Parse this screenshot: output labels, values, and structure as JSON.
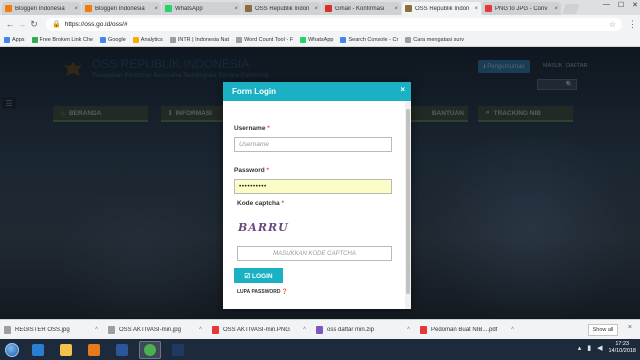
{
  "browser": {
    "tabs": [
      {
        "label": "Bloggen Indonesia",
        "favicon_color": "#f57c00",
        "active": false
      },
      {
        "label": "Bloggen Indonesia",
        "favicon_color": "#f57c00",
        "active": false
      },
      {
        "label": "WhatsApp",
        "favicon_color": "#25d366",
        "active": false
      },
      {
        "label": "OSS Republik Indon",
        "favicon_color": "#8d6e3a",
        "active": false
      },
      {
        "label": "Gmail - Konfirmasi",
        "favicon_color": "#d93025",
        "active": false
      },
      {
        "label": "OSS Republik Indon",
        "favicon_color": "#8d6e3a",
        "active": true
      },
      {
        "label": "PNG to JPG - Conv",
        "favicon_color": "#e53935",
        "active": false
      }
    ],
    "tab_close_glyph": "×",
    "window_controls": {
      "minimize": "—",
      "maximize": "☐",
      "close": "✕"
    },
    "url": "https://oss.go.id/oss/#",
    "bookmarks": [
      {
        "label": "Apps",
        "icon_color": "#4285f4"
      },
      {
        "label": "Free Broken Link Che",
        "icon_color": "#34a853"
      },
      {
        "label": "Google",
        "icon_color": "#4285f4"
      },
      {
        "label": "Analytics",
        "icon_color": "#f9ab00"
      },
      {
        "label": "INTR | Indonesia Nat",
        "icon_color": "#9e9e9e"
      },
      {
        "label": "Word Count Tool - F",
        "icon_color": "#9e9e9e"
      },
      {
        "label": "WhatsApp",
        "icon_color": "#25d366"
      },
      {
        "label": "Search Console - Cr",
        "icon_color": "#4285f4"
      },
      {
        "label": "Cara mengatasi surv",
        "icon_color": "#9e9e9e"
      }
    ]
  },
  "site": {
    "title": "OSS REPUBLIK INDONESIA",
    "subtitle": "Pelayanan Perizinan Berusaha Terintegrasi Secara Elektronik",
    "pengumuman": "ℹ Pengumuman",
    "masuk": "MASUK",
    "daftar": "DAFTAR",
    "search_icon": "search-icon",
    "nav": {
      "beranda": "BERANDA",
      "informasi": "INFORMASI",
      "bantuan": "BANTUAN",
      "tracking": "TRACKING NIB"
    }
  },
  "modal": {
    "title": "Form Login",
    "close_glyph": "×",
    "username_label": "Username",
    "username_placeholder": "Username",
    "password_label": "Password",
    "password_value": "••••••••••",
    "captcha_label": "Kode captcha",
    "captcha_text": "BARRU",
    "captcha_placeholder": "MASUKKAN KODE CAPTCHA",
    "required_mark": "*",
    "login_button": "☑ LOGIN",
    "forgot_password": "LUPA PASSWORD ❓"
  },
  "downloads": {
    "items": [
      {
        "label": "REGISTER OSS.jpg",
        "icon_color": "#9e9e9e"
      },
      {
        "label": "OSS AKTIVASI-min.jpg",
        "icon_color": "#9e9e9e"
      },
      {
        "label": "OSS AKTIVASI-min.PNG",
        "icon_color": "#e53935"
      },
      {
        "label": "oss daftar min.zip",
        "icon_color": "#7e57c2"
      },
      {
        "label": "Pedoman Buat NIB....pdf",
        "icon_color": "#e53935"
      }
    ],
    "show_all": "Show all",
    "close_glyph": "×"
  },
  "taskbar": {
    "apps": [
      {
        "name": "ie-icon",
        "color": "#2a7fd4",
        "active": false
      },
      {
        "name": "explorer-icon",
        "color": "#f2c14e",
        "active": false
      },
      {
        "name": "media-player-icon",
        "color": "#e87a1e",
        "active": false
      },
      {
        "name": "word-icon",
        "color": "#2b579a",
        "active": false
      },
      {
        "name": "chrome-icon",
        "color": "#4caf50",
        "active": true
      },
      {
        "name": "photoshop-icon",
        "color": "#1e3a5f",
        "active": false
      }
    ],
    "time": "17:23",
    "date": "14/10/2018"
  }
}
